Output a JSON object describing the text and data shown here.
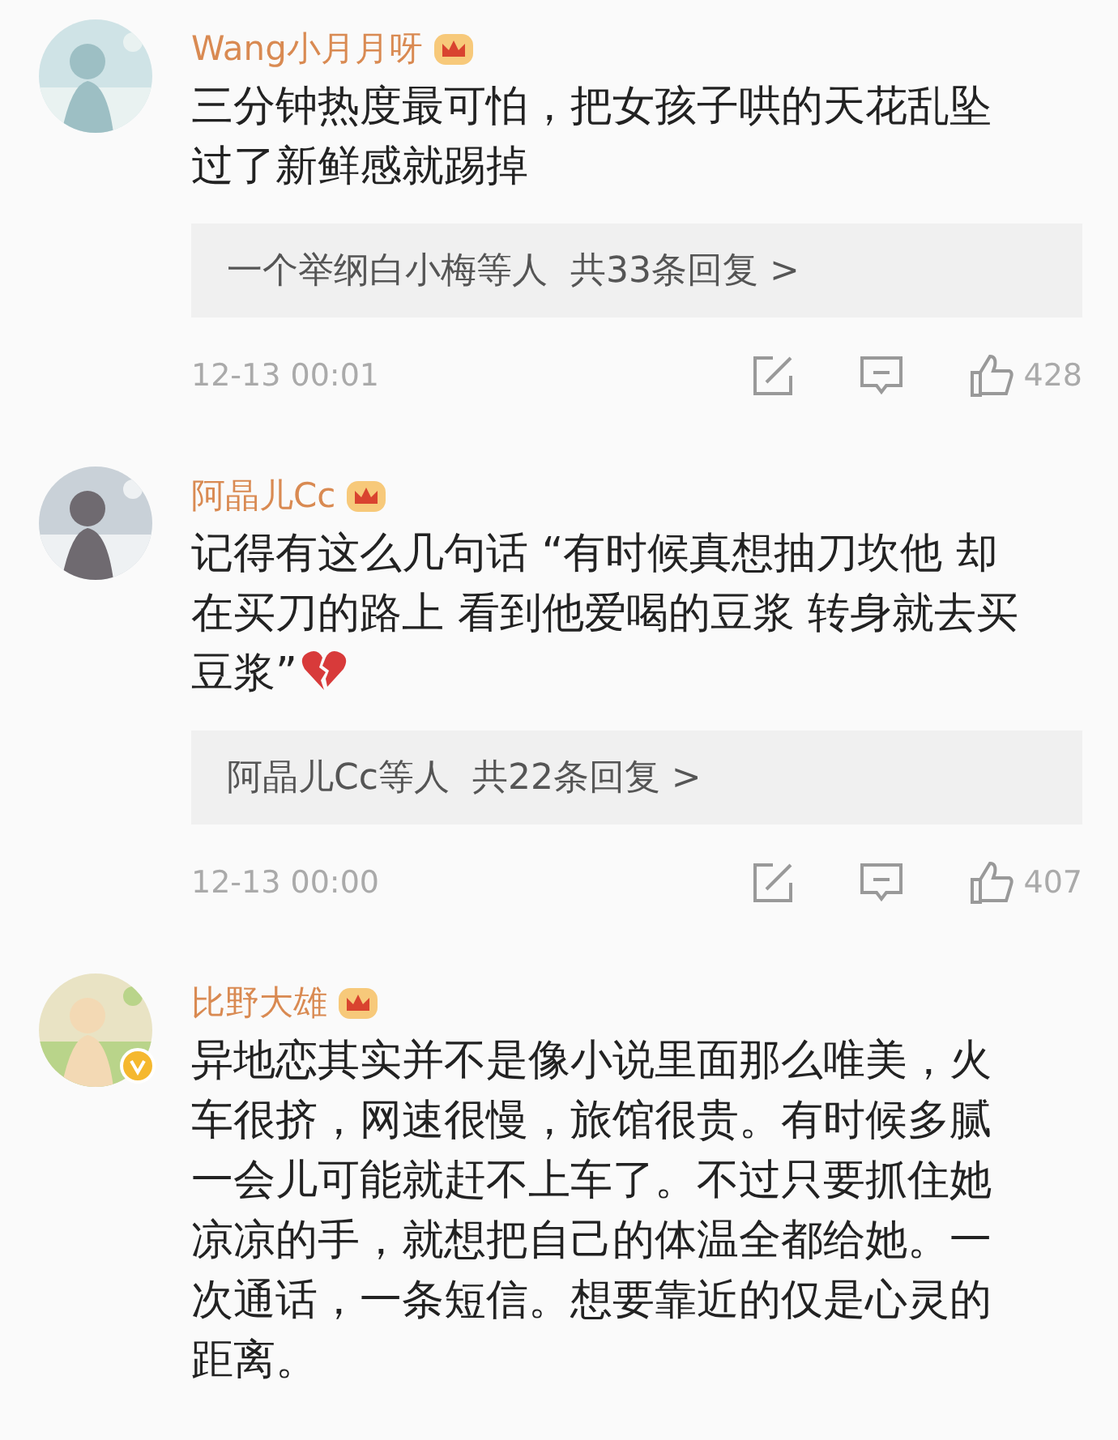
{
  "comments": [
    {
      "name": "Wang小月月呀",
      "verified": false,
      "text": "三分钟热度最可怕，把女孩子哄的天花乱坠过了新鲜感就踢掉",
      "emoji": false,
      "replies": "一个举纲白小梅等人  共33条回复 >",
      "time": "12-13 00:01",
      "likes": "428"
    },
    {
      "name": "阿晶儿Cc",
      "verified": false,
      "text": "记得有这么几句话 “有时候真想抽刀坎他 却在买刀的路上 看到他爱喝的豆浆 转身就去买豆浆”",
      "emoji": true,
      "replies": "阿晶儿Cc等人  共22条回复 >",
      "time": "12-13 00:00",
      "likes": "407"
    },
    {
      "name": "比野大雄",
      "verified": true,
      "text": "异地恋其实并不是像小说里面那么唯美，火车很挤，网速很慢，旅馆很贵。有时候多腻一会儿可能就赶不上车了。不过只要抓住她凉凉的手，就想把自己的体温全都给她。一次通话，一条短信。想要靠近的仅是心灵的距离。",
      "emoji": false
    }
  ]
}
